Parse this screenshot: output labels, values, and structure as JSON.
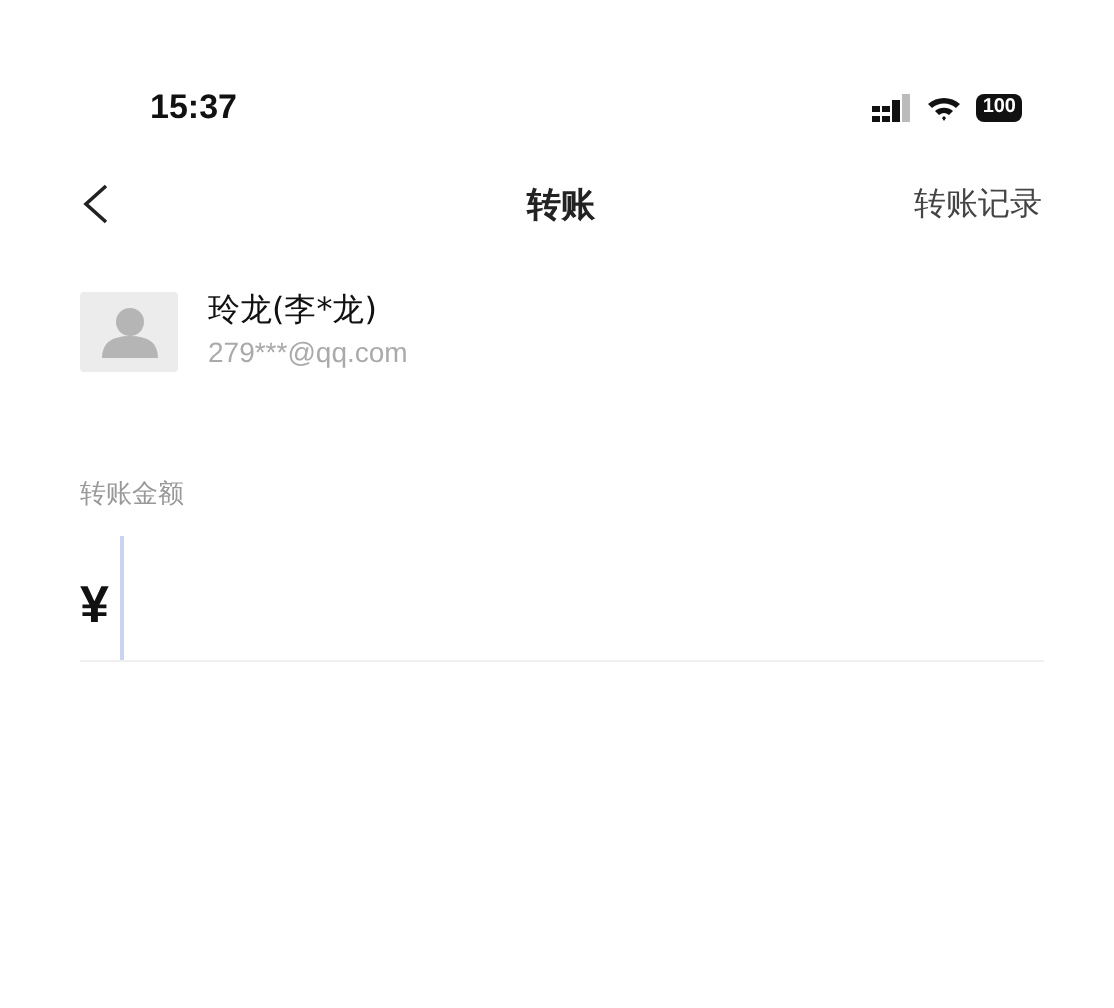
{
  "status_bar": {
    "time": "15:37",
    "battery": "100"
  },
  "nav": {
    "title": "转账",
    "action": "转账记录"
  },
  "recipient": {
    "name": "玲龙(李*龙)",
    "account": "279***@qq.com"
  },
  "amount": {
    "label": "转账金额",
    "currency": "¥"
  }
}
